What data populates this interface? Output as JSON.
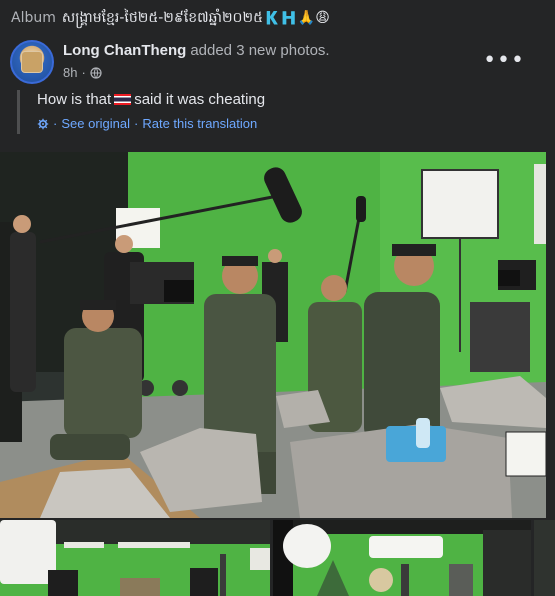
{
  "album": {
    "label": "Album",
    "title": "សង្គ្រាមខ្មែរ-ថៃ២៥-២៩ខែ៧ឆ្នាំ២០២៥🇰🇭🙏😩"
  },
  "post": {
    "author": "Long ChanTheng",
    "action": "added 3 new photos.",
    "time": "8h",
    "more_label": "•••",
    "translated_text_before": "How is that",
    "translated_text_after": "said it was cheating",
    "see_original": "See original",
    "rate_translation": "Rate this translation"
  },
  "photos": {
    "main": "film-set-soldiers-green-screen",
    "thumb_1": "green-screen-studio-set",
    "thumb_2": "green-screen-studio-set-2"
  },
  "colors": {
    "background": "#242526",
    "primary_text": "#e4e6eb",
    "secondary_text": "#b0b3b8",
    "link": "#6ea8ff",
    "green_screen": "#4fb344"
  }
}
